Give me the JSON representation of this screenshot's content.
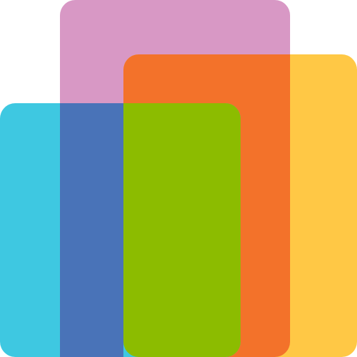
{
  "logo": {
    "name": "overlapping-rounded-rectangles-logo",
    "colors": {
      "pink": "#D898C5",
      "yellow": "#FFC845",
      "orange": "#F3722A",
      "cyan": "#3EC8E1",
      "blue": "#4973B8",
      "green": "#8CBC00"
    }
  }
}
